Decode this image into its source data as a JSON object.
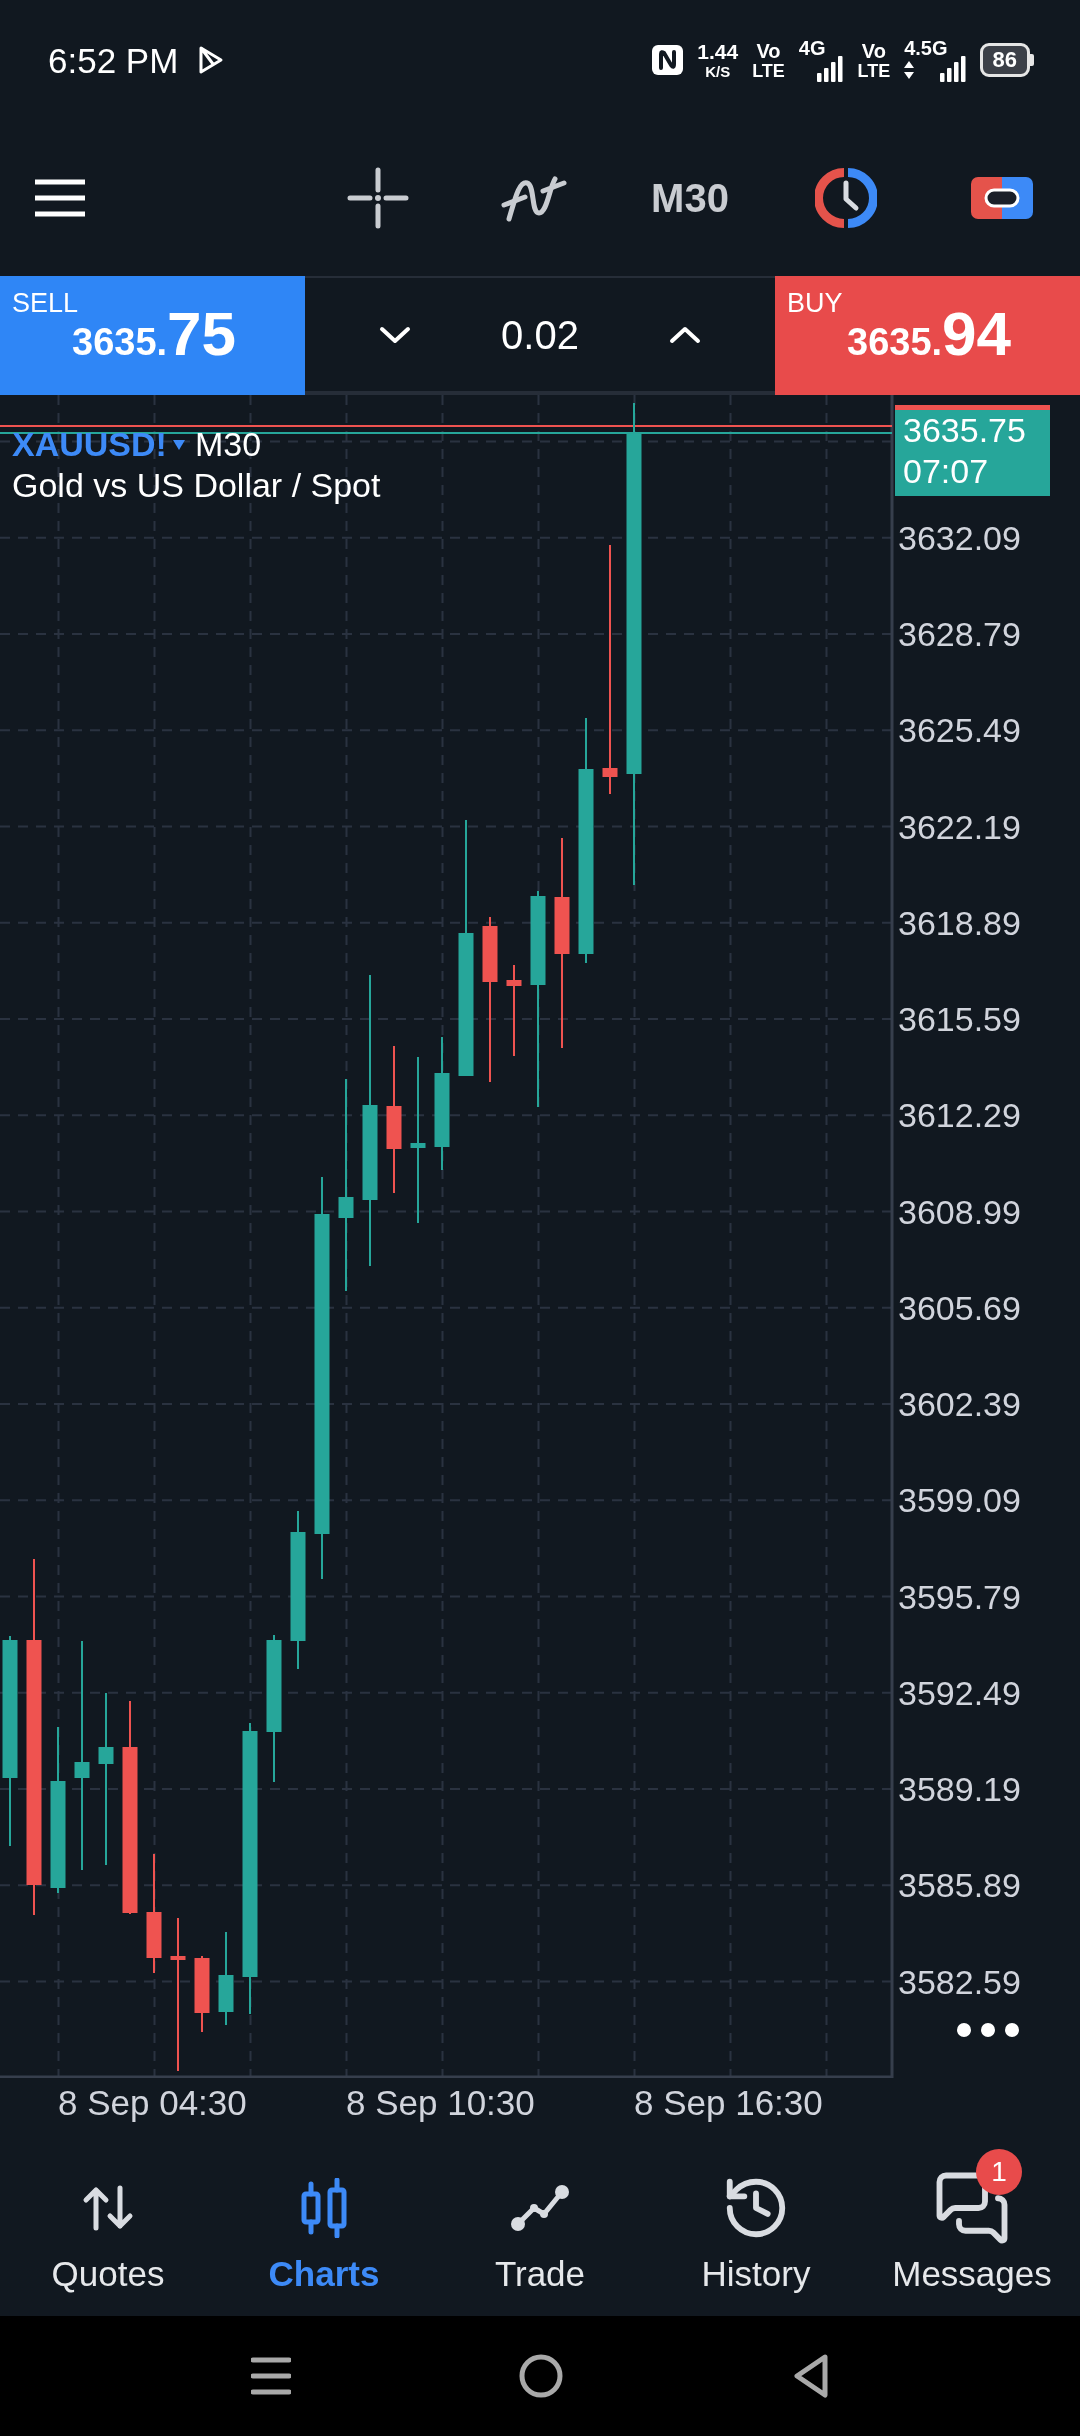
{
  "status_bar": {
    "time": "6:52 PM",
    "data_speed": {
      "value": "1.44",
      "unit": "K/S"
    },
    "sim_1": {
      "volte_top": "Vo",
      "volte_bottom": "LTE",
      "network": "4G"
    },
    "sim_2": {
      "volte_top": "Vo",
      "volte_bottom": "LTE",
      "network": "4.5G"
    },
    "battery": "86"
  },
  "toolbar": {
    "timeframe": "M30"
  },
  "trade_panel": {
    "sell": {
      "label": "SELL",
      "price": "3635.",
      "price_large": "75"
    },
    "lot": {
      "value": "0.02"
    },
    "buy": {
      "label": "BUY",
      "price": "3635.",
      "price_large": "94"
    }
  },
  "chart": {
    "symbol": "XAUUSD!",
    "timeframe": "M30",
    "description": "Gold vs US Dollar / Spot",
    "current_price": {
      "price": "3635.75",
      "countdown": "07:07"
    },
    "price_axis": [
      "3632.09",
      "3628.79",
      "3625.49",
      "3622.19",
      "3618.89",
      "3615.59",
      "3612.29",
      "3608.99",
      "3605.69",
      "3602.39",
      "3599.09",
      "3595.79",
      "3592.49",
      "3589.19",
      "3585.89",
      "3582.59"
    ],
    "time_axis": [
      "8 Sep 04:30",
      "8 Sep 10:30",
      "8 Sep 16:30"
    ]
  },
  "nav": {
    "items": [
      {
        "label": "Quotes",
        "selected": false
      },
      {
        "label": "Charts",
        "selected": true
      },
      {
        "label": "Trade",
        "selected": false
      },
      {
        "label": "History",
        "selected": false
      },
      {
        "label": "Messages",
        "selected": false,
        "badge": "1"
      }
    ]
  }
}
